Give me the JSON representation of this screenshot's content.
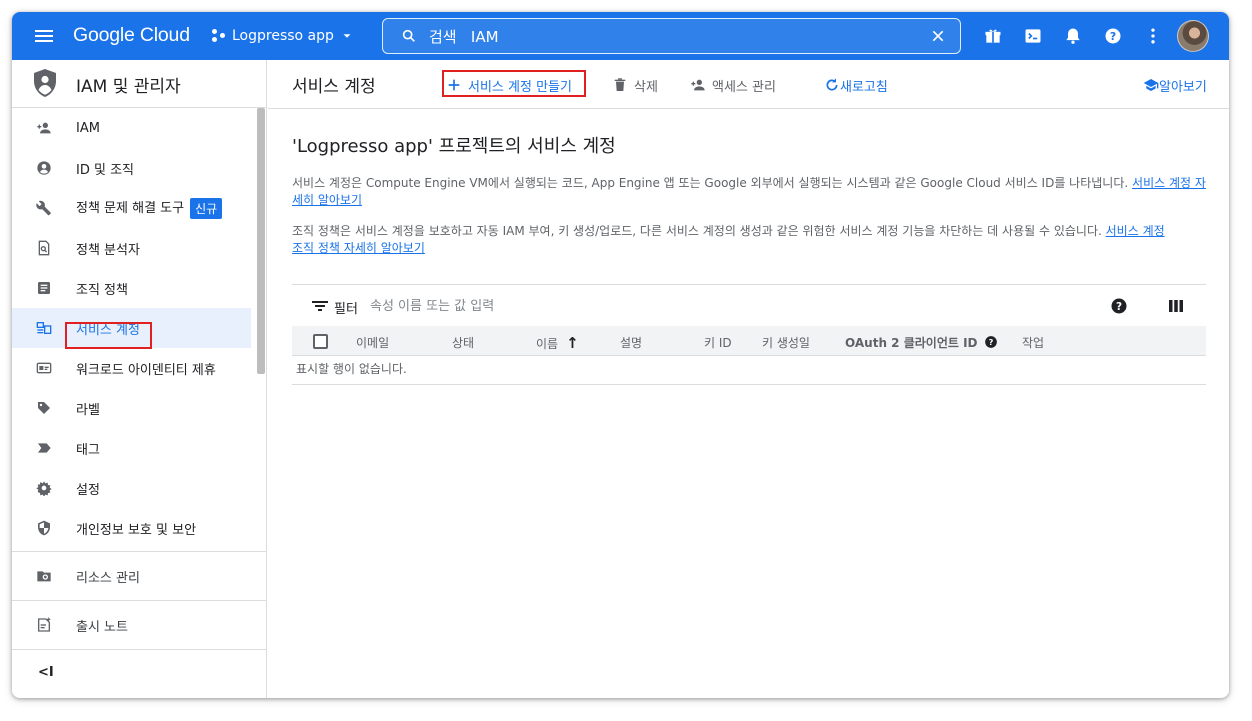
{
  "topbar": {
    "brand": "Google Cloud",
    "project_name": "Logpresso app",
    "search_value": "검색   IAM",
    "bg_color": "#1a73e8"
  },
  "sidebar": {
    "title": "IAM 및 관리자",
    "items": [
      {
        "label": "IAM",
        "icon": "person-add-icon"
      },
      {
        "label": "ID 및 조직",
        "icon": "account-circle-icon"
      },
      {
        "label": "정책 문제 해결 도구",
        "icon": "wrench-icon",
        "badge": "신규"
      },
      {
        "label": "정책 분석자",
        "icon": "document-search-icon"
      },
      {
        "label": "조직 정책",
        "icon": "list-document-icon"
      },
      {
        "label": "서비스 계정",
        "icon": "service-account-icon",
        "active": true
      },
      {
        "label": "워크로드 아이덴티티 제휴",
        "icon": "id-card-icon"
      },
      {
        "label": "라벨",
        "icon": "label-icon"
      },
      {
        "label": "태그",
        "icon": "tag-icon"
      },
      {
        "label": "설정",
        "icon": "gear-icon"
      },
      {
        "label": "개인정보 보호 및 보안",
        "icon": "shield-icon"
      }
    ],
    "bottom": [
      {
        "label": "리소스 관리",
        "icon": "folder-gear-icon"
      },
      {
        "label": "출시 노트",
        "icon": "release-notes-icon"
      }
    ],
    "collapse_label": "<I"
  },
  "toolbar": {
    "page_title": "서비스 계정",
    "create": "서비스 계정 만들기",
    "delete": "삭제",
    "manage_access": "액세스 관리",
    "refresh": "새로고침",
    "learn": "알아보기"
  },
  "content": {
    "heading": "'Logpresso app' 프로젝트의 서비스 계정",
    "desc1": "서비스 계정은 Compute Engine VM에서 실행되는 코드, App Engine 앱 또는 Google 외부에서 실행되는 시스템과 같은 Google Cloud 서비스 ID를 나타냅니다.",
    "desc1_link_a": "서비스 계정 자",
    "desc1_link_b": "세히 알아보기",
    "desc2": "조직 정책은 서비스 계정을 보호하고 자동 IAM 부여, 키 생성/업로드, 다른 서비스 계정의 생성과 같은 위험한 서비스 계정 기능을 차단하는 데 사용될 수 있습니다.",
    "desc2_link_a": "서비스 계정",
    "desc2_link_b": "조직 정책 자세히 알아보기"
  },
  "table": {
    "filter_label": "필터",
    "filter_placeholder": "속성 이름 또는 값 입력",
    "columns": [
      "이메일",
      "상태",
      "이름",
      "설명",
      "키 ID",
      "키 생성일",
      "OAuth 2 클라이언트 ID",
      "작업"
    ],
    "sort_indicator": "↑",
    "empty_message": "표시할 행이 없습니다."
  },
  "colors": {
    "accent": "#1a73e8",
    "highlight_box": "#e12121"
  }
}
